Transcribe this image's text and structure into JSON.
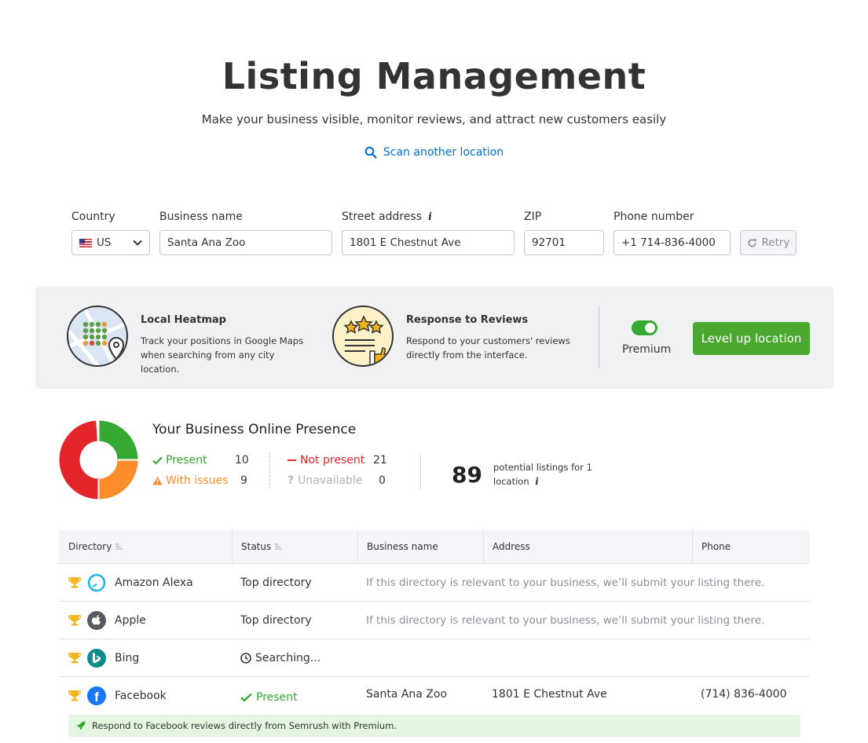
{
  "header": {
    "title": "Listing Management",
    "subtitle": "Make your business visible, monitor reviews, and attract new customers easily",
    "scan_link": "Scan another location"
  },
  "form": {
    "country_label": "Country",
    "country_value": "US",
    "business_label": "Business name",
    "business_value": "Santa Ana Zoo",
    "street_label": "Street address",
    "street_value": "1801 E Chestnut Ave",
    "zip_label": "ZIP",
    "zip_value": "92701",
    "phone_label": "Phone number",
    "phone_value": "+1 714-836-4000",
    "retry_label": "Retry"
  },
  "promo": {
    "heatmap_title": "Local Heatmap",
    "heatmap_desc": "Track your positions in Google Maps when searching from any city location.",
    "reviews_title": "Response to Reviews",
    "reviews_desc": "Respond to your customers' reviews directly from the interface.",
    "premium_label": "Premium",
    "levelup_label": "Level up location"
  },
  "presence": {
    "title": "Your Business Online Presence",
    "present_label": "Present",
    "present_count": "10",
    "issues_label": "With issues",
    "issues_count": "9",
    "not_present_label": "Not present",
    "not_present_count": "21",
    "unavailable_label": "Unavailable",
    "unavailable_count": "0",
    "total": "89",
    "total_desc": "potential listings for 1 location",
    "colors": {
      "present": "#35a931",
      "issues": "#fd8c2a",
      "not_present": "#e3242b",
      "unavailable": "#b0b4bd"
    }
  },
  "table": {
    "headers": {
      "directory": "Directory",
      "status": "Status",
      "business": "Business name",
      "address": "Address",
      "phone": "Phone"
    },
    "rows": [
      {
        "name": "Amazon Alexa",
        "icon": "alexa-icon",
        "status": "Top directory",
        "note": "If this directory is relevant to your business, we’ll submit your listing there."
      },
      {
        "name": "Apple",
        "icon": "apple-icon",
        "status": "Top directory",
        "note": "If this directory is relevant to your business, we’ll submit your listing there."
      },
      {
        "name": "Bing",
        "icon": "bing-icon",
        "status": "Searching..."
      },
      {
        "name": "Facebook",
        "icon": "facebook-icon",
        "status": "Present",
        "business": "Santa Ana Zoo",
        "address": "1801 E Chestnut Ave",
        "phone": "(714) 836-4000"
      }
    ],
    "banner": "Respond to Facebook reviews directly from Semrush with Premium."
  }
}
